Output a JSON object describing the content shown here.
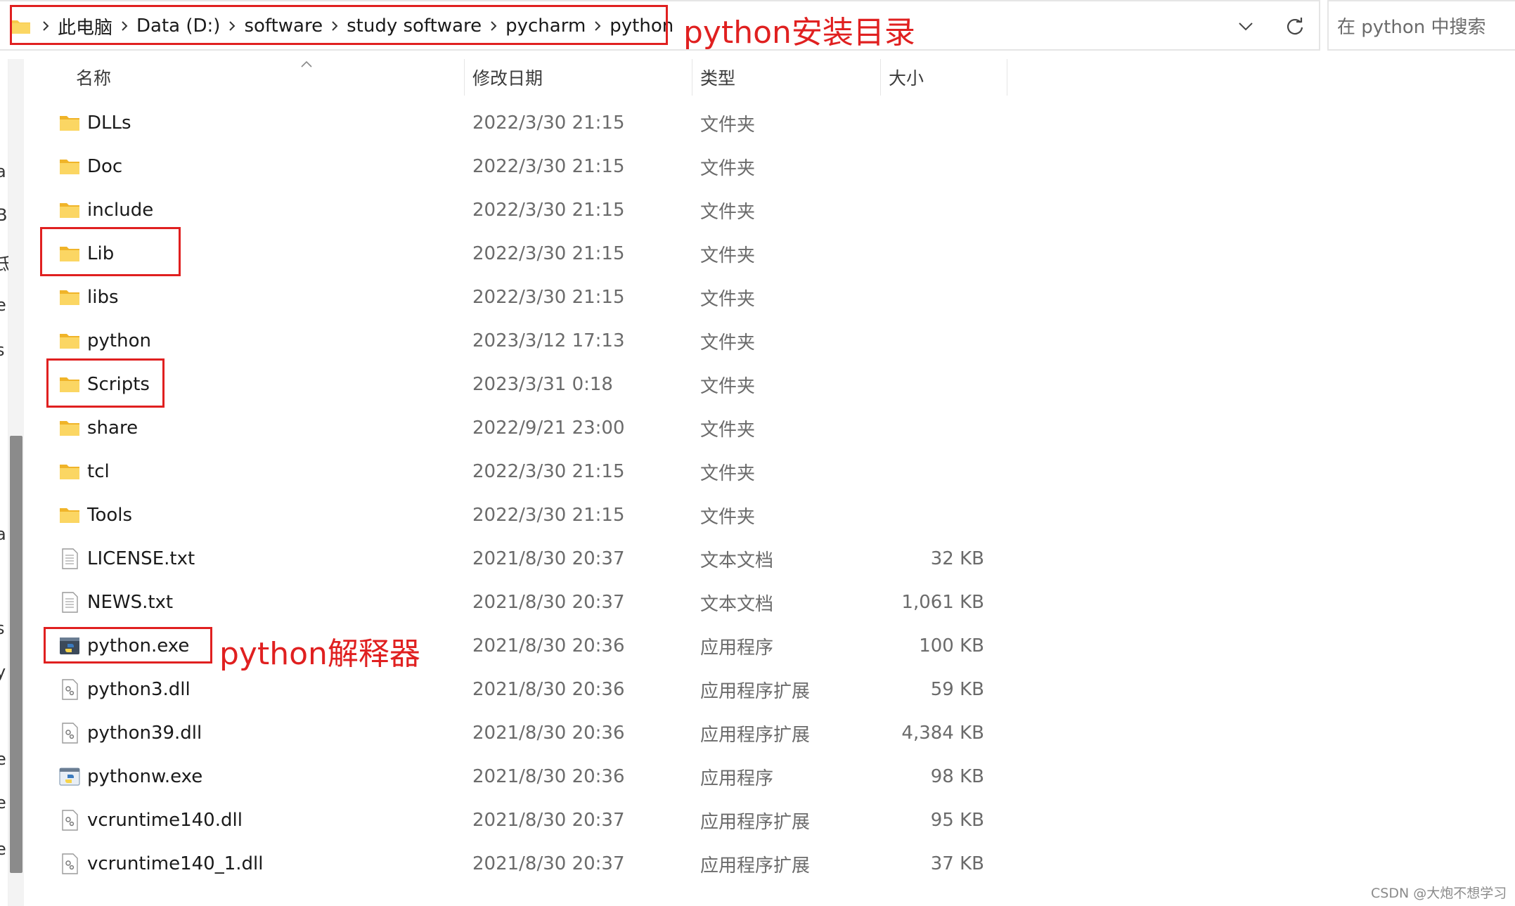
{
  "breadcrumb": {
    "items": [
      "此电脑",
      "Data (D:)",
      "software",
      "study software",
      "pycharm",
      "python"
    ]
  },
  "search": {
    "placeholder": "在 python 中搜索"
  },
  "annotations": {
    "install_dir": "python安装目录",
    "interpreter": "python解释器"
  },
  "nav_letters": [
    "a",
    "B",
    "氐",
    "e",
    "s",
    "a",
    "s",
    "y",
    "e",
    "e",
    "e"
  ],
  "columns": {
    "name": "名称",
    "date": "修改日期",
    "type": "类型",
    "size": "大小"
  },
  "files": [
    {
      "name": "DLLs",
      "date": "2022/3/30 21:15",
      "type": "文件夹",
      "size": "",
      "icon": "folder-icon"
    },
    {
      "name": "Doc",
      "date": "2022/3/30 21:15",
      "type": "文件夹",
      "size": "",
      "icon": "folder-icon"
    },
    {
      "name": "include",
      "date": "2022/3/30 21:15",
      "type": "文件夹",
      "size": "",
      "icon": "folder-icon"
    },
    {
      "name": "Lib",
      "date": "2022/3/30 21:15",
      "type": "文件夹",
      "size": "",
      "icon": "folder-icon"
    },
    {
      "name": "libs",
      "date": "2022/3/30 21:15",
      "type": "文件夹",
      "size": "",
      "icon": "folder-icon"
    },
    {
      "name": "python",
      "date": "2023/3/12 17:13",
      "type": "文件夹",
      "size": "",
      "icon": "folder-icon"
    },
    {
      "name": "Scripts",
      "date": "2023/3/31 0:18",
      "type": "文件夹",
      "size": "",
      "icon": "folder-icon"
    },
    {
      "name": "share",
      "date": "2022/9/21 23:00",
      "type": "文件夹",
      "size": "",
      "icon": "folder-icon"
    },
    {
      "name": "tcl",
      "date": "2022/3/30 21:15",
      "type": "文件夹",
      "size": "",
      "icon": "folder-icon"
    },
    {
      "name": "Tools",
      "date": "2022/3/30 21:15",
      "type": "文件夹",
      "size": "",
      "icon": "folder-icon"
    },
    {
      "name": "LICENSE.txt",
      "date": "2021/8/30 20:37",
      "type": "文本文档",
      "size": "32 KB",
      "icon": "text-file-icon"
    },
    {
      "name": "NEWS.txt",
      "date": "2021/8/30 20:37",
      "type": "文本文档",
      "size": "1,061 KB",
      "icon": "text-file-icon"
    },
    {
      "name": "python.exe",
      "date": "2021/8/30 20:36",
      "type": "应用程序",
      "size": "100 KB",
      "icon": "python-exe-icon"
    },
    {
      "name": "python3.dll",
      "date": "2021/8/30 20:36",
      "type": "应用程序扩展",
      "size": "59 KB",
      "icon": "dll-file-icon"
    },
    {
      "name": "python39.dll",
      "date": "2021/8/30 20:36",
      "type": "应用程序扩展",
      "size": "4,384 KB",
      "icon": "dll-file-icon"
    },
    {
      "name": "pythonw.exe",
      "date": "2021/8/30 20:36",
      "type": "应用程序",
      "size": "98 KB",
      "icon": "python-exe-icon"
    },
    {
      "name": "vcruntime140.dll",
      "date": "2021/8/30 20:37",
      "type": "应用程序扩展",
      "size": "95 KB",
      "icon": "dll-file-icon"
    },
    {
      "name": "vcruntime140_1.dll",
      "date": "2021/8/30 20:37",
      "type": "应用程序扩展",
      "size": "37 KB",
      "icon": "dll-file-icon"
    }
  ],
  "watermark": "CSDN @大炮不想学习",
  "colors": {
    "annotation": "#e02020",
    "folder": "#f8c84a",
    "text_secondary": "#6b6b6b"
  }
}
